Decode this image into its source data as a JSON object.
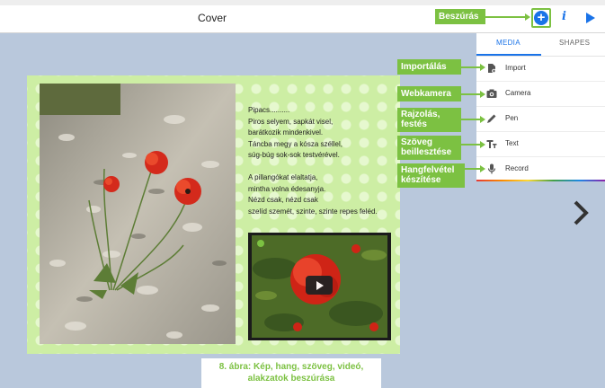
{
  "header": {
    "title": "Cover"
  },
  "toolbar": {
    "add_icon": "plus-circle-icon",
    "info_icon": "info-icon",
    "play_icon": "play-icon"
  },
  "panel": {
    "tabs": [
      {
        "label": "MEDIA",
        "active": true
      },
      {
        "label": "SHAPES",
        "active": false
      }
    ],
    "items": [
      {
        "label": "Import",
        "icon": "import-icon"
      },
      {
        "label": "Camera",
        "icon": "camera-icon"
      },
      {
        "label": "Pen",
        "icon": "pen-icon"
      },
      {
        "label": "Text",
        "icon": "text-icon"
      },
      {
        "label": "Record",
        "icon": "microphone-icon"
      }
    ]
  },
  "slide": {
    "poem": "Pipacs..........\nPiros selyem, sapkát visel,\nbarátkozik mindenkivel.\nTáncba megy a kósza széllel,\nsúg-búg sok-sok testvérével.\n\nA pillangókat elaltatja,\nmintha volna édesanyja.\nNézd csak, nézd csak\nszelíd szemét, szinte, szinte repes feléd."
  },
  "annotations": {
    "beszuras": "Beszúrás",
    "import": "Importálás",
    "camera": "Webkamera",
    "pen": "Rajzolás,\nfestés",
    "text": "Szöveg\nbeillesztése",
    "record": "Hangfelvétel\nkészítése"
  },
  "caption": "8. ábra: Kép, hang, szöveg, videó,\nalakzatok beszúrása",
  "colors": {
    "accent": "#1a73e8",
    "annotation": "#7cc142",
    "canvas": "#b9c8dc",
    "slide_bg": "#cdeea4"
  }
}
